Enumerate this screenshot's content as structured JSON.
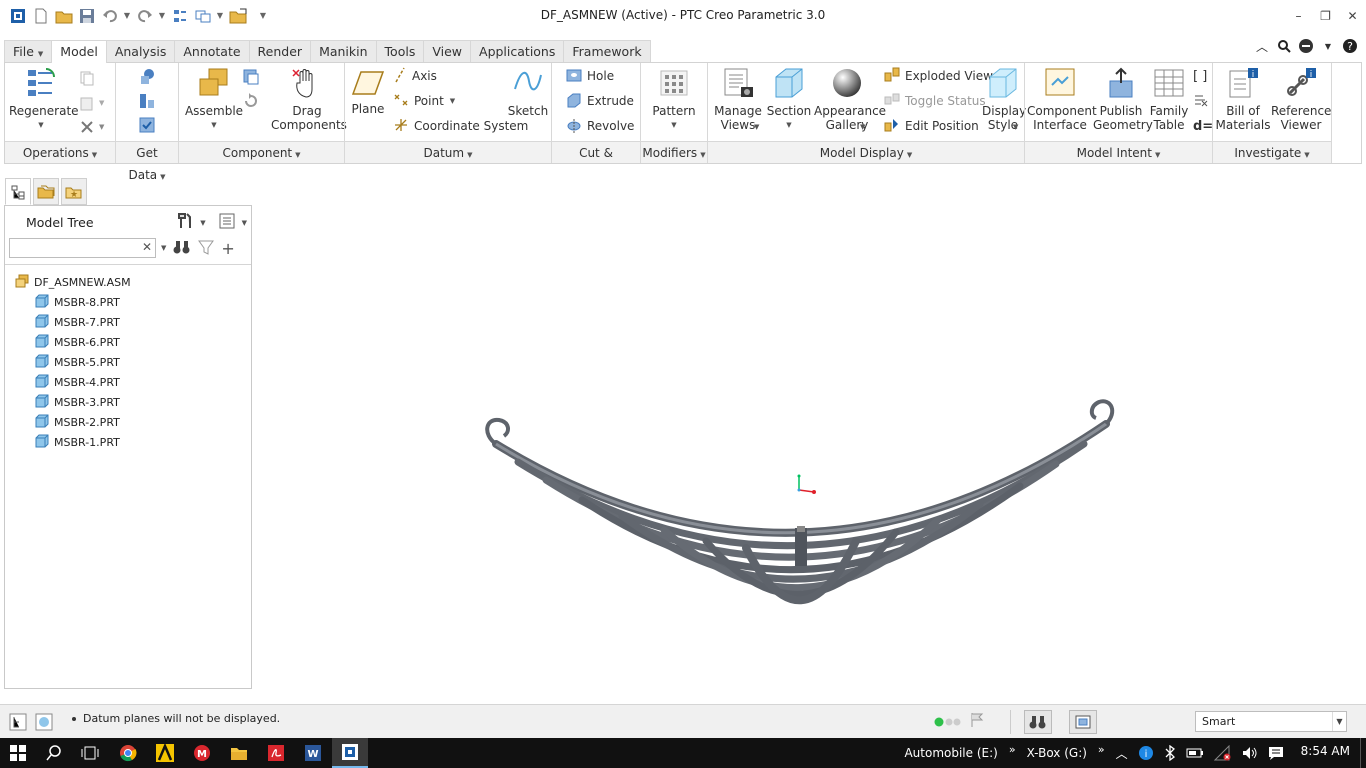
{
  "window": {
    "title": "DF_ASMNEW (Active) - PTC Creo Parametric 3.0"
  },
  "tabs": [
    {
      "label": "File",
      "active": false
    },
    {
      "label": "Model",
      "active": true
    },
    {
      "label": "Analysis",
      "active": false
    },
    {
      "label": "Annotate",
      "active": false
    },
    {
      "label": "Render",
      "active": false
    },
    {
      "label": "Manikin",
      "active": false
    },
    {
      "label": "Tools",
      "active": false
    },
    {
      "label": "View",
      "active": false
    },
    {
      "label": "Applications",
      "active": false
    },
    {
      "label": "Framework",
      "active": false
    }
  ],
  "ribbon": {
    "operations": {
      "regenerate": "Regenerate",
      "group": "Operations"
    },
    "get_data": {
      "group": "Get Data"
    },
    "component": {
      "assemble": "Assemble",
      "drag": "Drag\nComponents",
      "group": "Component"
    },
    "datum": {
      "plane": "Plane",
      "axis": "Axis",
      "point": "Point",
      "csys": "Coordinate System",
      "sketch": "Sketch",
      "group": "Datum"
    },
    "cut_surface": {
      "hole": "Hole",
      "extrude": "Extrude",
      "revolve": "Revolve",
      "group": "Cut & Surface"
    },
    "modifiers": {
      "pattern": "Pattern",
      "group": "Modifiers"
    },
    "model_display": {
      "manage_views": "Manage\nViews",
      "section": "Section",
      "appearance": "Appearance\nGallery",
      "exploded_view": "Exploded View",
      "toggle_status": "Toggle Status",
      "edit_position": "Edit Position",
      "display_style": "Display\nStyle",
      "group": "Model Display"
    },
    "model_intent": {
      "component_interface": "Component\nInterface",
      "publish_geometry": "Publish\nGeometry",
      "family_table": "Family\nTable",
      "group": "Model Intent"
    },
    "investigate": {
      "bom": "Bill of\nMaterials",
      "reference_viewer": "Reference\nViewer",
      "group": "Investigate"
    }
  },
  "model_tree": {
    "title": "Model Tree",
    "search_placeholder": "",
    "root": "DF_ASMNEW.ASM",
    "items": [
      "MSBR-8.PRT",
      "MSBR-7.PRT",
      "MSBR-6.PRT",
      "MSBR-5.PRT",
      "MSBR-4.PRT",
      "MSBR-3.PRT",
      "MSBR-2.PRT",
      "MSBR-1.PRT"
    ]
  },
  "status": {
    "message": "Datum planes will not be displayed.",
    "filter": "Smart"
  },
  "taskbar": {
    "drive1": "Automobile (E:)",
    "drive2": "X-Box (G:)",
    "time": "8:54 AM"
  },
  "colors": {
    "tab_active": "#ffffff",
    "ribbon_group_label_bg": "#f2f2f2",
    "model_steel": "#6f747c",
    "taskbar": "#111111",
    "csys_green": "#00c060",
    "csys_red": "#e0202a"
  }
}
